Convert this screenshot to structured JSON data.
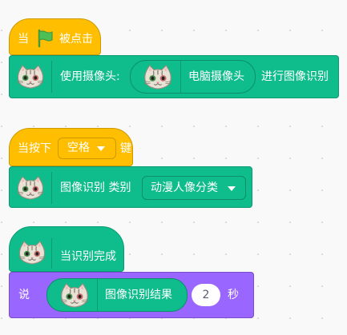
{
  "script1": {
    "hat_prefix": "当",
    "hat_suffix": "被点击",
    "use_camera": "使用摄像头:",
    "camera_option": "电脑摄像头",
    "recognize": "进行图像识别"
  },
  "script2": {
    "when_pressed": "当按下",
    "key": "空格",
    "key_suffix": "键",
    "classify_label": "图像识别 类别",
    "category": "动漫人像分类"
  },
  "script3": {
    "when_done": "当识别完成",
    "say": "说",
    "result": "图像识别结果",
    "seconds_value": "2",
    "seconds_label": "秒"
  },
  "colors": {
    "events": "#ffbf00",
    "extension": "#0fbd8c",
    "looks": "#9966ff",
    "flag": "#4cbf56"
  },
  "icons": {
    "flag": "green-flag-icon",
    "cat": "cat-face-icon",
    "dropdown": "dropdown-arrow-icon"
  }
}
